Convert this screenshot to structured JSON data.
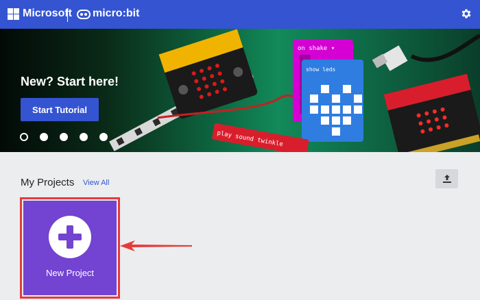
{
  "header": {
    "brand": "Microsoft",
    "product": "micro:bit",
    "logo_icon": "microsoft-logo-icon",
    "product_icon": "microbit-logo-icon",
    "settings_icon": "gear-icon",
    "bg_color": "#3454d1"
  },
  "hero": {
    "title": "New? Start here!",
    "button_label": "Start Tutorial",
    "carousel_dots": 5,
    "active_dot": 0,
    "art_blocks": {
      "on_shake": "on shake ▾",
      "show_leds": "show leds",
      "play_sound": "play sound twinkle"
    }
  },
  "projects": {
    "title": "My Projects",
    "view_all": "View All",
    "upload_icon": "upload-icon",
    "new_project_label": "New Project",
    "card_color": "#7343d1",
    "highlight_color": "#e63a3a"
  }
}
